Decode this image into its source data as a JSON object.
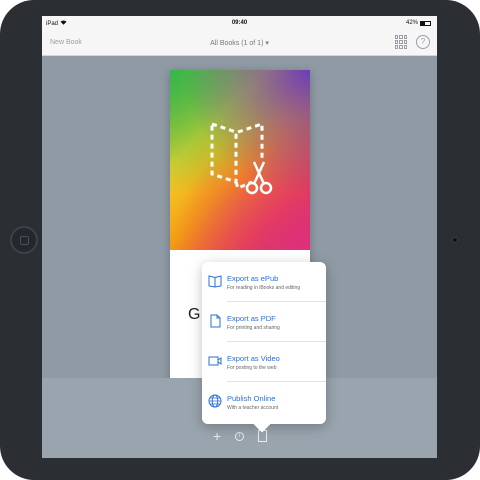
{
  "status_bar": {
    "device": "iPad",
    "wifi": "wifi-icon",
    "time": "09:40",
    "battery_percent": "42%",
    "battery_level": 0.42
  },
  "nav": {
    "new_book": "New Book",
    "title": "All Books (1 of 1)",
    "title_chevron": "▾",
    "info_glyph": "?"
  },
  "book": {
    "visible_title_fragment": "G"
  },
  "menu": {
    "items": [
      {
        "title": "Export as ePub",
        "subtitle": "For reading in iBooks and editing",
        "icon": "book-icon"
      },
      {
        "title": "Export as PDF",
        "subtitle": "For printing and sharing",
        "icon": "document-icon"
      },
      {
        "title": "Export as Video",
        "subtitle": "For posting to the web",
        "icon": "video-icon"
      },
      {
        "title": "Publish Online",
        "subtitle": "With a teacher account",
        "icon": "globe-icon"
      }
    ]
  },
  "toolbar": {
    "add_glyph": "+",
    "info_glyph": "i"
  },
  "colors": {
    "accent": "#2a6fd6",
    "screen_bg": "#8f9aa5",
    "device": "#2b2e33"
  }
}
